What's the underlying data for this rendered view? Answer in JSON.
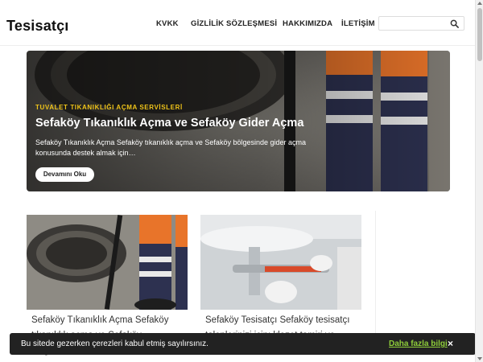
{
  "header": {
    "logo": "Tesisatçı",
    "nav": [
      "KVKK",
      "GİZLİLİK SÖZLEŞMESİ",
      "HAKKIMIZDA",
      "İLETİŞİM"
    ],
    "search_placeholder": ""
  },
  "hero": {
    "category": "TUVALET TIKANIKLIĞI AÇMA SERVİSLERİ",
    "title": "Sefaköy Tıkanıklık Açma ve Sefaköy Gider Açma",
    "excerpt": "Sefaköy Tıkanıklık Açma Sefaköy tıkanıklık açma ve Sefaköy bölgesinde gider açma konusunda destek almak için…",
    "button": "Devamını Oku"
  },
  "cards": [
    {
      "title": "Sefaköy Tıkanıklık Açma Sefaköy tıkanıklık açma ve Sefaköy bölgesinde"
    },
    {
      "title": "Sefaköy Tesisatçı Sefaköy tesisatçı taleplerinizi için; klozet tamiri ve"
    }
  ],
  "cookie": {
    "text": "Bu sitede gezerken çerezleri kabul etmiş sayılırsınız.",
    "link": "Daha fazla bilgi",
    "close": "×"
  },
  "colors": {
    "category": "#f0c419",
    "cookie_bg": "#222222",
    "cookie_link": "#8fce3a"
  }
}
